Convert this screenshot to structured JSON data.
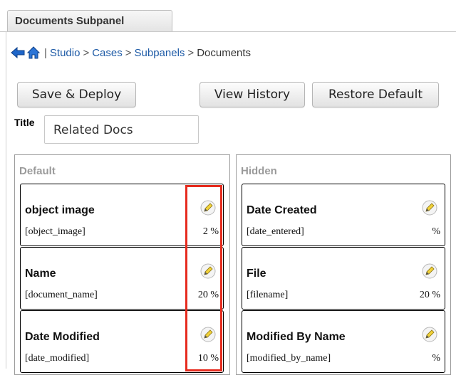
{
  "tab": {
    "label": "Documents Subpanel"
  },
  "breadcrumb": {
    "separator_pipe": "|",
    "items": [
      "Studio",
      "Cases",
      "Subpanels",
      "Documents"
    ],
    "arrow": ">"
  },
  "buttons": {
    "save_deploy": "Save & Deploy",
    "view_history": "View History",
    "restore_default": "Restore Default"
  },
  "title_field": {
    "label": "Title",
    "value": "Related Docs"
  },
  "panels": {
    "default": {
      "heading": "Default",
      "fields": [
        {
          "name": "object image",
          "key": "[object_image]",
          "width": "2 %"
        },
        {
          "name": "Name",
          "key": "[document_name]",
          "width": "20 %"
        },
        {
          "name": "Date Modified",
          "key": "[date_modified]",
          "width": "10 %"
        }
      ]
    },
    "hidden": {
      "heading": "Hidden",
      "fields": [
        {
          "name": "Date Created",
          "key": "[date_entered]",
          "width": "%"
        },
        {
          "name": "File",
          "key": "[filename]",
          "width": "20 %"
        },
        {
          "name": "Modified By Name",
          "key": "[modified_by_name]",
          "width": "%"
        }
      ]
    }
  },
  "icons": {
    "back": "back-arrow-icon",
    "home": "home-icon",
    "edit": "pencil-edit-icon"
  },
  "colors": {
    "highlight": "#e62b1e",
    "link": "#1d5aa6",
    "panel_heading": "#9a9a9a"
  }
}
